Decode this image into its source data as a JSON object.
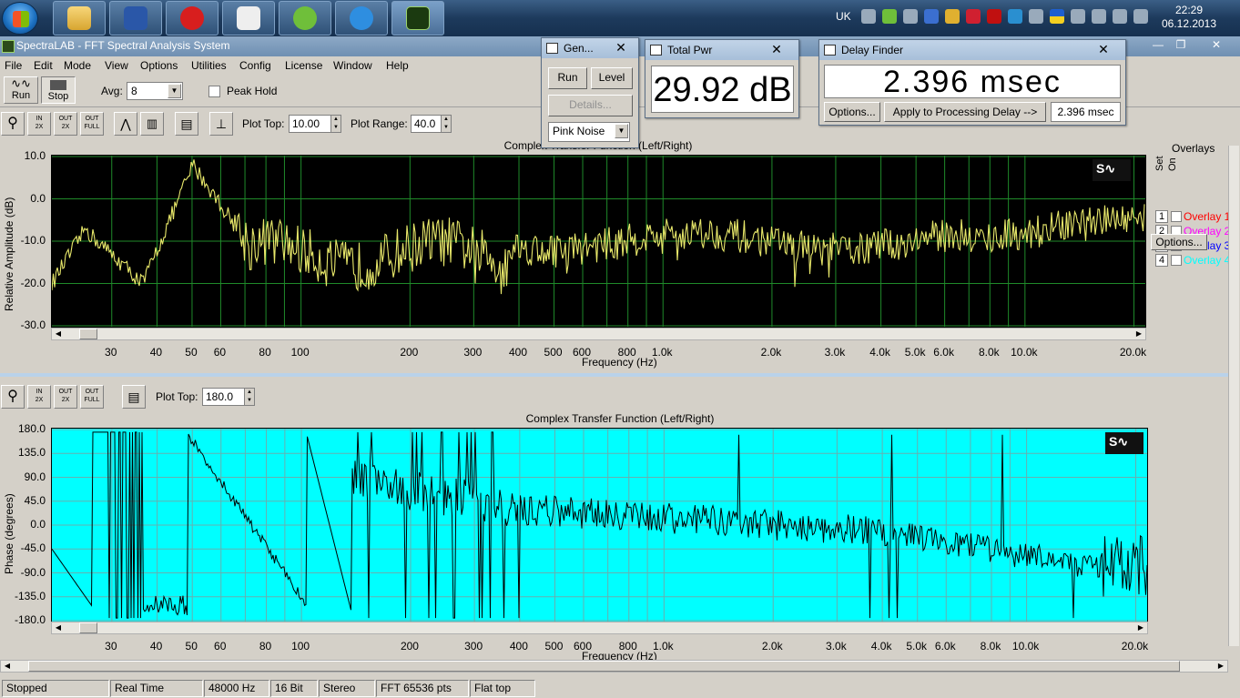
{
  "taskbar": {
    "tray_lang": "UK",
    "clock_time": "22:29",
    "clock_date": "06.12.2013"
  },
  "app": {
    "title": "SpectraLAB - FFT Spectral Analysis System",
    "menu": [
      "File",
      "Edit",
      "Mode",
      "View",
      "Options",
      "Utilities",
      "Config",
      "License",
      "Window",
      "Help"
    ]
  },
  "toolbar": {
    "run_label": "Run",
    "stop_label": "Stop",
    "avg_label": "Avg:",
    "avg_value": "8",
    "peak_hold_label": "Peak Hold",
    "plot_top_label": "Plot Top:",
    "plot_top_value": "10.00",
    "plot_range_label": "Plot Range:",
    "plot_range_value": "40.0",
    "phase_plot_top_label": "Plot Top:",
    "phase_plot_top_value": "180.0",
    "icon_in_label": "IN",
    "icon_out_label": "OUT",
    "icon_full_label": "FULL",
    "icon_2x_label": "2X"
  },
  "amplitude_plot": {
    "title": "Complex Transfer Function (Left/Right)",
    "ylabel": "Relative Amplitude (dB)",
    "xlabel": "Frequency (Hz)",
    "y_ticks": [
      "10.0",
      "0.0",
      "-10.0",
      "-20.0",
      "-30.0"
    ],
    "x_ticks": [
      "30",
      "40",
      "50",
      "60",
      "80",
      "100",
      "200",
      "300",
      "400",
      "500",
      "600",
      "800",
      "1.0k",
      "2.0k",
      "3.0k",
      "4.0k",
      "5.0k",
      "6.0k",
      "8.0k",
      "10.0k",
      "20.0k"
    ],
    "colors": {
      "background": "#000000",
      "grid": "#1f8a2a",
      "trace": "#e8e86a"
    }
  },
  "phase_plot": {
    "title": "Complex Transfer Function (Left/Right)",
    "ylabel": "Phase (degrees)",
    "xlabel": "Frequency (Hz)",
    "y_ticks": [
      "180.0",
      "135.0",
      "90.0",
      "45.0",
      "0.0",
      "-45.0",
      "-90.0",
      "-135.0",
      "-180.0"
    ],
    "x_ticks": [
      "30",
      "40",
      "50",
      "60",
      "80",
      "100",
      "200",
      "300",
      "400",
      "500",
      "600",
      "800",
      "1.0k",
      "2.0k",
      "3.0k",
      "4.0k",
      "5.0k",
      "6.0k",
      "8.0k",
      "10.0k",
      "20.0k"
    ],
    "colors": {
      "background": "#00ffff",
      "grid": "#66b0b0",
      "trace": "#000000"
    }
  },
  "overlays": {
    "title": "Overlays",
    "set_label": "Set",
    "on_label": "On",
    "items": [
      {
        "num": "1",
        "label": "Overlay 1",
        "color": "#ff0000"
      },
      {
        "num": "2",
        "label": "Overlay 2",
        "color": "#ff00ff"
      },
      {
        "num": "3",
        "label": "Overlay 3",
        "color": "#0000ff"
      },
      {
        "num": "4",
        "label": "Overlay 4",
        "color": "#00ffff"
      }
    ],
    "options_label": "Options..."
  },
  "generator": {
    "title": "Gen...",
    "run_label": "Run",
    "level_label": "Level",
    "details_label": "Details...",
    "noise_value": "Pink Noise"
  },
  "total_pwr": {
    "title": "Total Pwr",
    "value": "29.92 dB"
  },
  "delay_finder": {
    "title": "Delay Finder",
    "value": "2.396 msec",
    "options_label": "Options...",
    "apply_label": "Apply to Processing Delay -->",
    "delay_field": "2.396 msec"
  },
  "status": {
    "state": "Stopped",
    "mode": "Real Time",
    "rate": "48000 Hz",
    "bits": "16 Bit",
    "channels": "Stereo",
    "fft": "FFT 65536 pts",
    "window": "Flat top"
  }
}
